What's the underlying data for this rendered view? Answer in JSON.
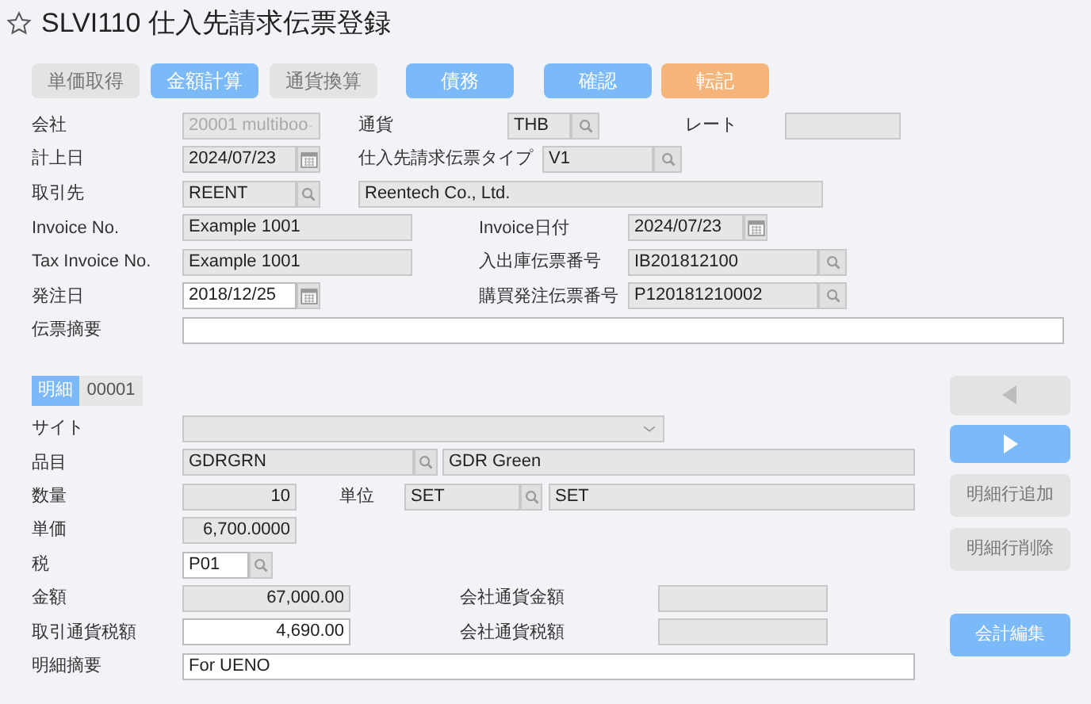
{
  "title": "SLVI110 仕入先請求伝票登録",
  "favorite": false,
  "toolbar": [
    {
      "label": "単価取得",
      "kind": "neutral"
    },
    {
      "label": "金額計算",
      "kind": "primary"
    },
    {
      "label": "通貨換算",
      "kind": "neutral"
    },
    {
      "label": "債務",
      "kind": "primary"
    },
    {
      "label": "確認",
      "kind": "primary"
    },
    {
      "label": "転記",
      "kind": "accent"
    }
  ],
  "header": {
    "company": {
      "label": "会社",
      "value": "20001 multiboo",
      "disabled": true
    },
    "currency": {
      "label": "通貨",
      "value": "THB",
      "editable": false
    },
    "rate": {
      "label": "レート",
      "editable": false
    },
    "posting_date": {
      "label": "計上日",
      "value": "2024/07/23",
      "editable": false
    },
    "invoice_type": {
      "label": "仕入先請求伝票タイプ",
      "value": "V1",
      "editable": false
    },
    "supplier": {
      "label": "取引先",
      "code": "REENT",
      "name": "Reentech Co., Ltd.",
      "editable": false
    },
    "invoice_no": {
      "label": "Invoice No.",
      "value": "Example 1001",
      "editable": false
    },
    "invoice_date": {
      "label": "Invoice日付",
      "value": "2024/07/23",
      "editable": false
    },
    "tax_invoice_no": {
      "label": "Tax Invoice No.",
      "value": "Example 1001",
      "editable": false
    },
    "receipt_no": {
      "label": "入出庫伝票番号",
      "value": "IB201812100",
      "editable": false
    },
    "order_date": {
      "label": "発注日",
      "value": "2018/12/25",
      "editable": true
    },
    "po_no": {
      "label": "購買発注伝票番号",
      "value": "P120181210002",
      "editable": false
    },
    "memo": {
      "label": "伝票摘要",
      "editable": true
    }
  },
  "detail": {
    "tab": {
      "label": "明細",
      "selected": true
    },
    "line_no": "00001",
    "site": {
      "label": "サイト",
      "disabled": true
    },
    "item": {
      "label": "品目",
      "code": "GDRGRN",
      "name": "GDR Green",
      "editable": false
    },
    "quantity": {
      "label": "数量",
      "value": "10",
      "editable": false
    },
    "unit": {
      "label": "単位",
      "code": "SET",
      "name": "SET",
      "editable": false
    },
    "unit_price": {
      "label": "単価",
      "value": "6,700.0000",
      "editable": false
    },
    "tax": {
      "label": "税",
      "value": "P01",
      "editable": true
    },
    "amount": {
      "label": "金額",
      "value": "67,000.00",
      "editable": false
    },
    "company_amount": {
      "label": "会社通貨金額",
      "editable": false
    },
    "tax_amount": {
      "label": "取引通貨税額",
      "value": "4,690.00",
      "editable": true
    },
    "company_tax_amount": {
      "label": "会社通貨税額",
      "editable": false
    },
    "line_memo": {
      "label": "明細摘要",
      "value": "For UENO",
      "editable": true
    }
  },
  "side_buttons": [
    {
      "kind": "prev",
      "disabled": true
    },
    {
      "kind": "next",
      "disabled": false
    },
    {
      "kind": "text",
      "label": "明細行追加",
      "disabled": true
    },
    {
      "kind": "text",
      "label": "明細行削除",
      "disabled": true
    },
    {
      "kind": "text",
      "label": "会計編集",
      "disabled": false
    }
  ]
}
